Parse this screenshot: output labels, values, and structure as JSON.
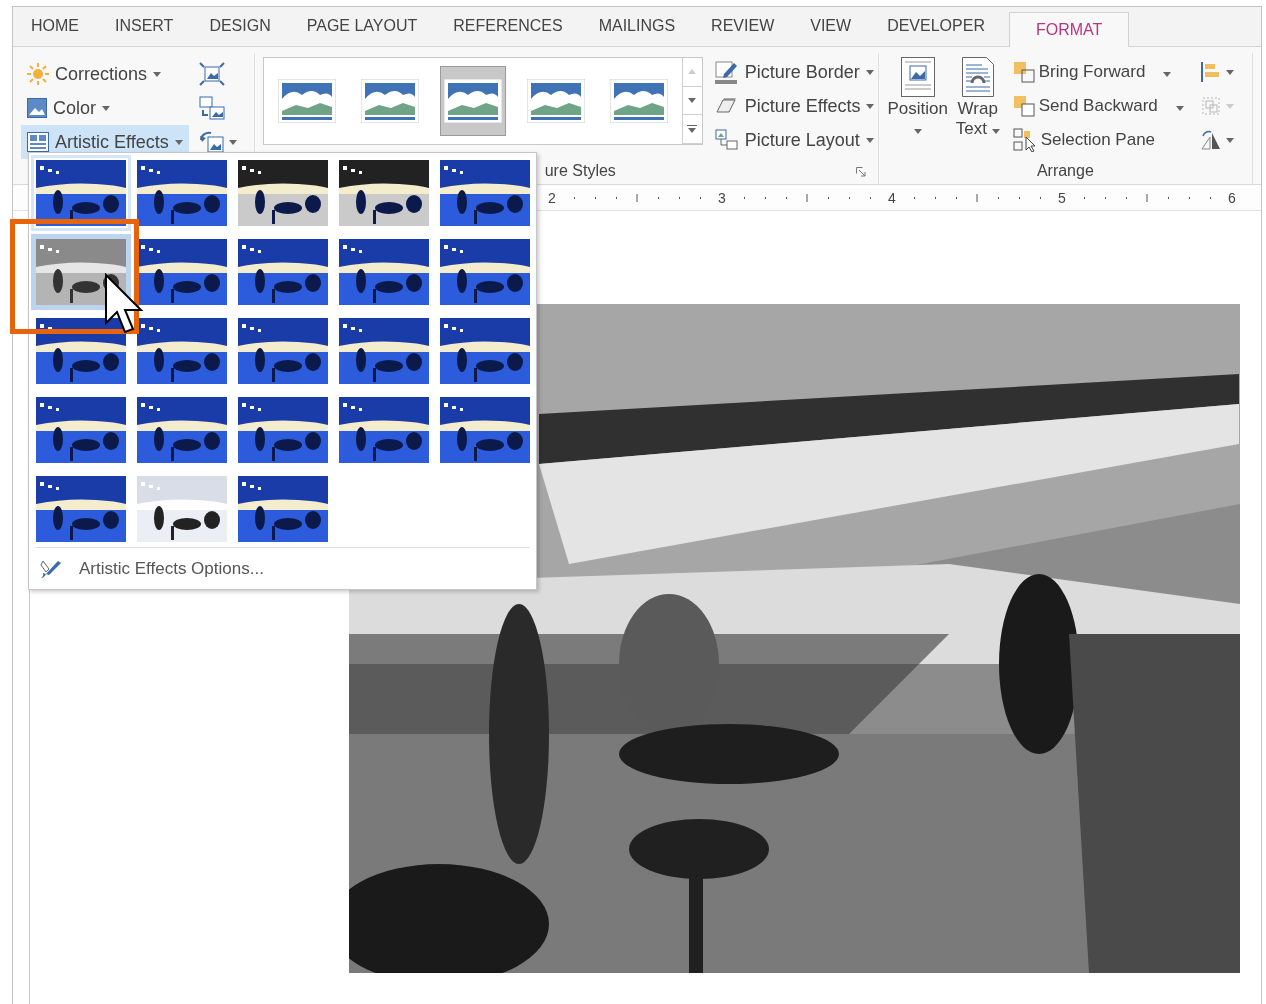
{
  "tabs": [
    {
      "label": "HOME",
      "selected": false
    },
    {
      "label": "INSERT",
      "selected": false
    },
    {
      "label": "DESIGN",
      "selected": false
    },
    {
      "label": "PAGE LAYOUT",
      "selected": false
    },
    {
      "label": "REFERENCES",
      "selected": false
    },
    {
      "label": "MAILINGS",
      "selected": false
    },
    {
      "label": "REVIEW",
      "selected": false
    },
    {
      "label": "VIEW",
      "selected": false
    },
    {
      "label": "DEVELOPER",
      "selected": false
    },
    {
      "label": "FORMAT",
      "selected": true
    }
  ],
  "adjust": {
    "commands": [
      {
        "kind": "corrections",
        "label": "Corrections",
        "selected": false
      },
      {
        "kind": "color",
        "label": "Color",
        "selected": false
      },
      {
        "kind": "artistic",
        "label": "Artistic Effects",
        "selected": true
      }
    ]
  },
  "picture_styles": {
    "label": "ure Styles",
    "styles": [
      {
        "selected": false
      },
      {
        "selected": false
      },
      {
        "selected": true
      },
      {
        "selected": false
      },
      {
        "selected": false
      }
    ],
    "commands": [
      {
        "kind": "border",
        "label": "Picture Border"
      },
      {
        "kind": "effects",
        "label": "Picture Effects"
      },
      {
        "kind": "layout",
        "label": "Picture Layout"
      }
    ]
  },
  "arrange": {
    "label": "Arrange",
    "large": [
      {
        "kind": "position",
        "label": "Position"
      },
      {
        "kind": "wrap",
        "label": "Wrap Text"
      }
    ],
    "commands": [
      {
        "kind": "forward",
        "label": "Bring Forward"
      },
      {
        "kind": "backward",
        "label": "Send Backward"
      },
      {
        "kind": "pane",
        "label": "Selection Pane"
      }
    ]
  },
  "ruler": {
    "labels": [
      "2",
      "3",
      "4",
      "5",
      "6"
    ]
  },
  "artistic_effects_menu": {
    "effects": [
      {
        "selected": true,
        "hovered": false
      },
      {
        "selected": false,
        "hovered": false
      },
      {
        "selected": false,
        "hovered": false
      },
      {
        "selected": false,
        "hovered": false
      },
      {
        "selected": false,
        "hovered": false
      },
      {
        "selected": false,
        "hovered": true
      },
      {
        "selected": false,
        "hovered": false
      },
      {
        "selected": false,
        "hovered": false
      },
      {
        "selected": false,
        "hovered": false
      },
      {
        "selected": false,
        "hovered": false
      },
      {
        "selected": false,
        "hovered": false
      },
      {
        "selected": false,
        "hovered": false
      },
      {
        "selected": false,
        "hovered": false
      },
      {
        "selected": false,
        "hovered": false
      },
      {
        "selected": false,
        "hovered": false
      },
      {
        "selected": false,
        "hovered": false
      },
      {
        "selected": false,
        "hovered": false
      },
      {
        "selected": false,
        "hovered": false
      },
      {
        "selected": false,
        "hovered": false
      },
      {
        "selected": false,
        "hovered": false
      },
      {
        "selected": false,
        "hovered": false
      },
      {
        "selected": false,
        "hovered": false
      },
      {
        "selected": false,
        "hovered": false
      }
    ],
    "options_label": "Artistic Effects Options..."
  }
}
